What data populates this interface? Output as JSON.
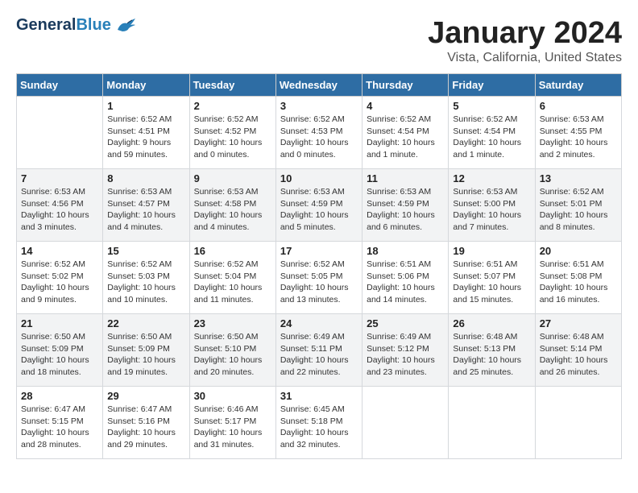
{
  "header": {
    "logo_general": "General",
    "logo_blue": "Blue",
    "month_title": "January 2024",
    "location": "Vista, California, United States"
  },
  "days_of_week": [
    "Sunday",
    "Monday",
    "Tuesday",
    "Wednesday",
    "Thursday",
    "Friday",
    "Saturday"
  ],
  "weeks": [
    [
      {
        "day": "",
        "info": ""
      },
      {
        "day": "1",
        "info": "Sunrise: 6:52 AM\nSunset: 4:51 PM\nDaylight: 9 hours\nand 59 minutes."
      },
      {
        "day": "2",
        "info": "Sunrise: 6:52 AM\nSunset: 4:52 PM\nDaylight: 10 hours\nand 0 minutes."
      },
      {
        "day": "3",
        "info": "Sunrise: 6:52 AM\nSunset: 4:53 PM\nDaylight: 10 hours\nand 0 minutes."
      },
      {
        "day": "4",
        "info": "Sunrise: 6:52 AM\nSunset: 4:54 PM\nDaylight: 10 hours\nand 1 minute."
      },
      {
        "day": "5",
        "info": "Sunrise: 6:52 AM\nSunset: 4:54 PM\nDaylight: 10 hours\nand 1 minute."
      },
      {
        "day": "6",
        "info": "Sunrise: 6:53 AM\nSunset: 4:55 PM\nDaylight: 10 hours\nand 2 minutes."
      }
    ],
    [
      {
        "day": "7",
        "info": "Sunrise: 6:53 AM\nSunset: 4:56 PM\nDaylight: 10 hours\nand 3 minutes."
      },
      {
        "day": "8",
        "info": "Sunrise: 6:53 AM\nSunset: 4:57 PM\nDaylight: 10 hours\nand 4 minutes."
      },
      {
        "day": "9",
        "info": "Sunrise: 6:53 AM\nSunset: 4:58 PM\nDaylight: 10 hours\nand 4 minutes."
      },
      {
        "day": "10",
        "info": "Sunrise: 6:53 AM\nSunset: 4:59 PM\nDaylight: 10 hours\nand 5 minutes."
      },
      {
        "day": "11",
        "info": "Sunrise: 6:53 AM\nSunset: 4:59 PM\nDaylight: 10 hours\nand 6 minutes."
      },
      {
        "day": "12",
        "info": "Sunrise: 6:53 AM\nSunset: 5:00 PM\nDaylight: 10 hours\nand 7 minutes."
      },
      {
        "day": "13",
        "info": "Sunrise: 6:52 AM\nSunset: 5:01 PM\nDaylight: 10 hours\nand 8 minutes."
      }
    ],
    [
      {
        "day": "14",
        "info": "Sunrise: 6:52 AM\nSunset: 5:02 PM\nDaylight: 10 hours\nand 9 minutes."
      },
      {
        "day": "15",
        "info": "Sunrise: 6:52 AM\nSunset: 5:03 PM\nDaylight: 10 hours\nand 10 minutes."
      },
      {
        "day": "16",
        "info": "Sunrise: 6:52 AM\nSunset: 5:04 PM\nDaylight: 10 hours\nand 11 minutes."
      },
      {
        "day": "17",
        "info": "Sunrise: 6:52 AM\nSunset: 5:05 PM\nDaylight: 10 hours\nand 13 minutes."
      },
      {
        "day": "18",
        "info": "Sunrise: 6:51 AM\nSunset: 5:06 PM\nDaylight: 10 hours\nand 14 minutes."
      },
      {
        "day": "19",
        "info": "Sunrise: 6:51 AM\nSunset: 5:07 PM\nDaylight: 10 hours\nand 15 minutes."
      },
      {
        "day": "20",
        "info": "Sunrise: 6:51 AM\nSunset: 5:08 PM\nDaylight: 10 hours\nand 16 minutes."
      }
    ],
    [
      {
        "day": "21",
        "info": "Sunrise: 6:50 AM\nSunset: 5:09 PM\nDaylight: 10 hours\nand 18 minutes."
      },
      {
        "day": "22",
        "info": "Sunrise: 6:50 AM\nSunset: 5:09 PM\nDaylight: 10 hours\nand 19 minutes."
      },
      {
        "day": "23",
        "info": "Sunrise: 6:50 AM\nSunset: 5:10 PM\nDaylight: 10 hours\nand 20 minutes."
      },
      {
        "day": "24",
        "info": "Sunrise: 6:49 AM\nSunset: 5:11 PM\nDaylight: 10 hours\nand 22 minutes."
      },
      {
        "day": "25",
        "info": "Sunrise: 6:49 AM\nSunset: 5:12 PM\nDaylight: 10 hours\nand 23 minutes."
      },
      {
        "day": "26",
        "info": "Sunrise: 6:48 AM\nSunset: 5:13 PM\nDaylight: 10 hours\nand 25 minutes."
      },
      {
        "day": "27",
        "info": "Sunrise: 6:48 AM\nSunset: 5:14 PM\nDaylight: 10 hours\nand 26 minutes."
      }
    ],
    [
      {
        "day": "28",
        "info": "Sunrise: 6:47 AM\nSunset: 5:15 PM\nDaylight: 10 hours\nand 28 minutes."
      },
      {
        "day": "29",
        "info": "Sunrise: 6:47 AM\nSunset: 5:16 PM\nDaylight: 10 hours\nand 29 minutes."
      },
      {
        "day": "30",
        "info": "Sunrise: 6:46 AM\nSunset: 5:17 PM\nDaylight: 10 hours\nand 31 minutes."
      },
      {
        "day": "31",
        "info": "Sunrise: 6:45 AM\nSunset: 5:18 PM\nDaylight: 10 hours\nand 32 minutes."
      },
      {
        "day": "",
        "info": ""
      },
      {
        "day": "",
        "info": ""
      },
      {
        "day": "",
        "info": ""
      }
    ]
  ]
}
